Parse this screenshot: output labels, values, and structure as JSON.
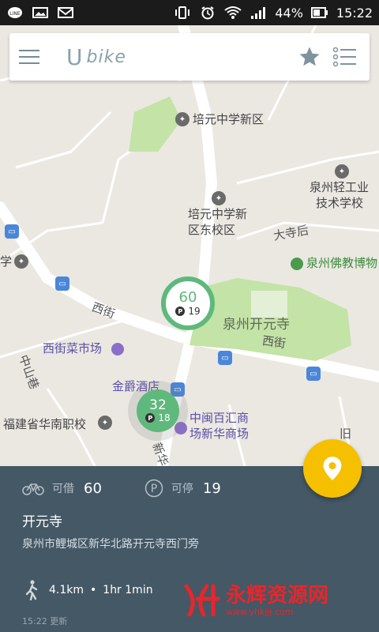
{
  "status_bar": {
    "left_icons": [
      "line-icon",
      "image-icon",
      "mail-icon"
    ],
    "battery_percent": "44%",
    "time": "15:22"
  },
  "app_bar": {
    "logo_text": "bike",
    "logo_prefix": "U"
  },
  "map_labels": {
    "school_new": "培元中学新区",
    "school_east": "培元中学新\n区东校区",
    "school_east_line1": "培元中学新",
    "school_east_line2": "区东校区",
    "light_industry_line1": "泉州轻工业",
    "light_industry_line2": "技术学校",
    "dasi_road": "大寺后",
    "buddhism_museum": "泉州佛教博物",
    "kaiyuan_temple": "泉州开元寺",
    "xijie_left": "西街",
    "xijie_right": "西街",
    "xijie_market": "西街菜市场",
    "jinjue_hotel": "金爵酒店",
    "fujian_school": "福建省华南职校",
    "zhongmin_line1": "中闽百汇商",
    "zhongmin_line2": "场新华商场",
    "zhongmin_road": "中山巷",
    "xue_left": "学",
    "xin_road": "新华",
    "jiu_road": "旧"
  },
  "markers": [
    {
      "bikes": "60",
      "parks": "19"
    },
    {
      "bikes": "32",
      "parks": "18"
    }
  ],
  "panel": {
    "borrow_label": "可借",
    "borrow_value": "60",
    "park_label": "可停",
    "park_value": "19",
    "station_name": "开元寺",
    "address": "泉州市鲤城区新华北路开元寺西门旁",
    "distance": "4.1km",
    "time": "1hr 1min",
    "updated": "15:22 更新"
  },
  "watermark": {
    "text": "永辉资源网",
    "url": "www.yhkjjj.com"
  },
  "colors": {
    "panel_bg": "#445866",
    "fab": "#f5c000",
    "marker_green": "#5fb87c"
  }
}
